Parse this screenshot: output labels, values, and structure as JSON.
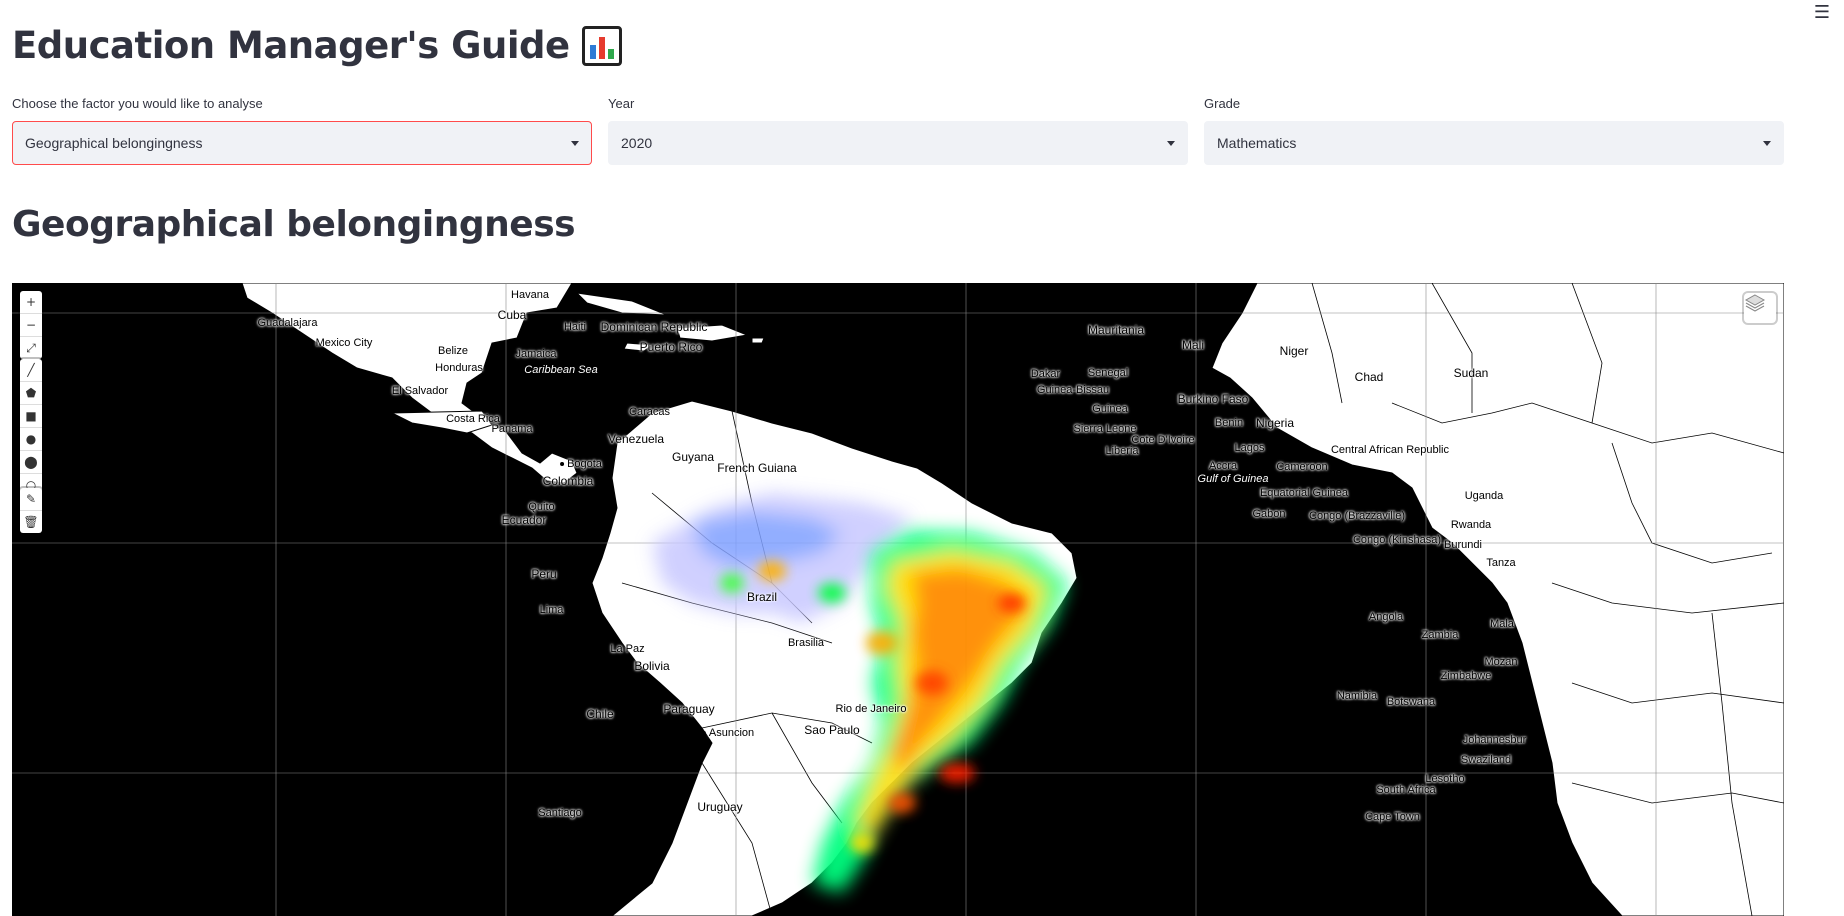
{
  "app": {
    "title": "Education Manager's Guide",
    "title_icon": "bar-chart-emoji",
    "menu_icon": "☰"
  },
  "filters": {
    "factor": {
      "label": "Choose the factor you would like to analyse",
      "value": "Geographical belongingness"
    },
    "year": {
      "label": "Year",
      "value": "2020"
    },
    "grade": {
      "label": "Grade",
      "value": "Mathematics"
    }
  },
  "section": {
    "title": "Geographical belongingness"
  },
  "map": {
    "background": "#000000",
    "land_color": "#ffffff",
    "heatmap_colors": [
      "#0000ff",
      "#00ffff",
      "#00ff00",
      "#ffff00",
      "#ff0000"
    ],
    "controls": {
      "zoom_in": "+",
      "zoom_out": "−",
      "fullscreen": "⤢",
      "polyline": "╱",
      "polygon": "⬟",
      "rectangle": "■",
      "circle": "●",
      "marker": "⬤",
      "circlemarker": "○",
      "edit": "✎",
      "delete": "🗑"
    },
    "place_labels": [
      "Havana",
      "Cuba",
      "Guadalajara",
      "Mexico City",
      "Haiti",
      "Dominican Republic",
      "Puerto Rico",
      "Belize",
      "Jamaica",
      "Caribbean Sea",
      "Honduras",
      "El Salvador",
      "Costa Rica",
      "Panama",
      "Caracas",
      "Venezuela",
      "Guyana",
      "French Guiana",
      "Bogota",
      "Colombia",
      "Quito",
      "Ecuador",
      "Peru",
      "Lima",
      "Brazil",
      "Brasilia",
      "La Paz",
      "Bolivia",
      "Paraguay",
      "Chile",
      "Asuncion",
      "Rio de Janeiro",
      "Sao Paulo",
      "Uruguay",
      "Santiago",
      "Mauritania",
      "Mali",
      "Niger",
      "Chad",
      "Sudan",
      "Dakar",
      "Senegal",
      "Guinea-Bissau",
      "Burkino Faso",
      "Guinea",
      "Benin",
      "Nigeria",
      "Sierra Leone",
      "Cote D'Ivoire",
      "Liberia",
      "Lagos",
      "Central African Republic",
      "Accra",
      "Gulf of Guinea",
      "Cameroon",
      "Equatorial Guinea",
      "Uganda",
      "Gabon",
      "Congo (Brazzaville)",
      "Rwanda",
      "Congo (Kinshasa)",
      "Burundi",
      "Tanza",
      "Angola",
      "Zambia",
      "Mala",
      "Mozan",
      "Zimbabwe",
      "Namibia",
      "Botswana",
      "Johannesbur",
      "Swaziland",
      "Lesotho",
      "South Africa",
      "Cape Town"
    ]
  }
}
